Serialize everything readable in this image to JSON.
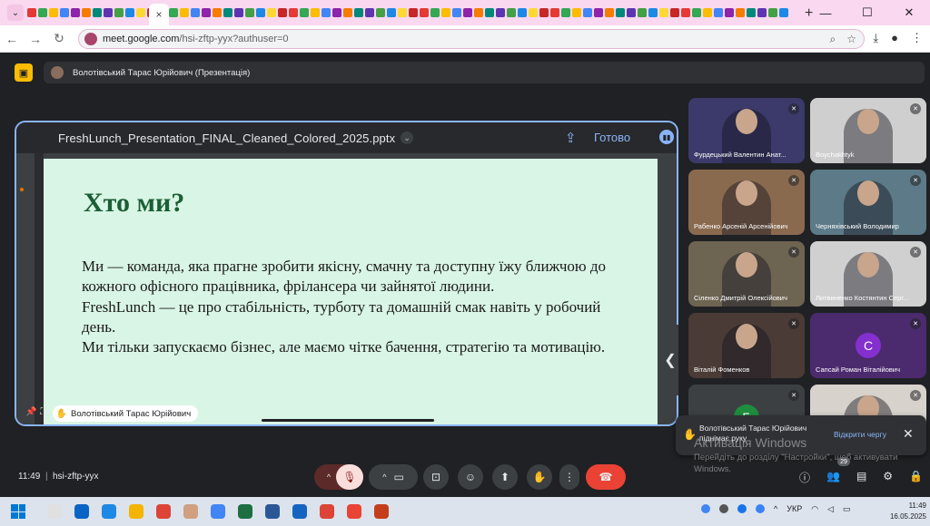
{
  "browser": {
    "url_host": "meet.google.com",
    "url_path": "/hsi-zftp-yyx?authuser=0",
    "active_tab_close": "×",
    "new_tab": "+"
  },
  "meet": {
    "presenter_chip": "Волотівський Тарас Юрійович (Презентація)",
    "presentation": {
      "file_name": "FreshLunch_Presentation_FINAL_Cleaned_Colored_2025.pptx",
      "done_label": "Готово",
      "slide_title": "Хто ми?",
      "slide_body": [
        "Ми — команда, яка прагне зробити якісну, смачну та доступну їжу ближчою до кожного офісного працівника, фрілансера чи зайнятої людини.",
        "FreshLunch — це про стабільність, турботу та домашній смак навіть у робочий день.",
        "Ми тільки запускаємо бізнес, але маємо чітке бачення, стратегію та мотивацію."
      ],
      "presenter_name": "Волотівський Тарас Юрійович"
    },
    "participants": [
      {
        "name": "Фурдецький Валентин Анат...",
        "bg": "#3b3a6a"
      },
      {
        "name": "Boychakhtyk",
        "bg": "#cfcfcf"
      },
      {
        "name": "Рабенко Арсеній Арсенійович",
        "bg": "#8a6a4f"
      },
      {
        "name": "Черняхівський Володимир",
        "bg": "#5c7a87"
      },
      {
        "name": "Сіленко Дмитрій Олексійович",
        "bg": "#6e6452"
      },
      {
        "name": "Литвиненко Костянтин Серг...",
        "bg": "#d0d0d0"
      },
      {
        "name": "Віталій Фоменков",
        "bg": "#4a3b36"
      },
      {
        "name": "Сапсай Роман Віталійович",
        "bg": "#4b2a6e",
        "initial": "С",
        "avatar": "#8430ce"
      },
      {
        "name": "",
        "bg": "#3c4043",
        "initial": "Б",
        "avatar": "#1e8e3e"
      },
      {
        "name": "",
        "bg": "#d8d2cc"
      }
    ],
    "notification": {
      "text": "Волотівський Тарас Юрійович піднімає руку",
      "action": "Відкрити чергу",
      "close": "✕"
    },
    "watermark": {
      "title": "Активація Windows",
      "subtitle": "Перейдіть до розділу \"Настройки\", щоб активувати Windows."
    },
    "bottom_bar": {
      "time": "11:49",
      "separator": "|",
      "meeting_code": "hsi-zftp-yyx",
      "people_count": "29"
    }
  },
  "taskbar": {
    "lang": "УКР",
    "time": "11:49",
    "date": "16.05.2025"
  },
  "colors": {
    "accent": "#8ab4f8",
    "slide_bg": "#d9f5e5",
    "slide_title": "#1b5e35",
    "hangup": "#ea4335",
    "tab_strip": "#f9d8f0"
  }
}
